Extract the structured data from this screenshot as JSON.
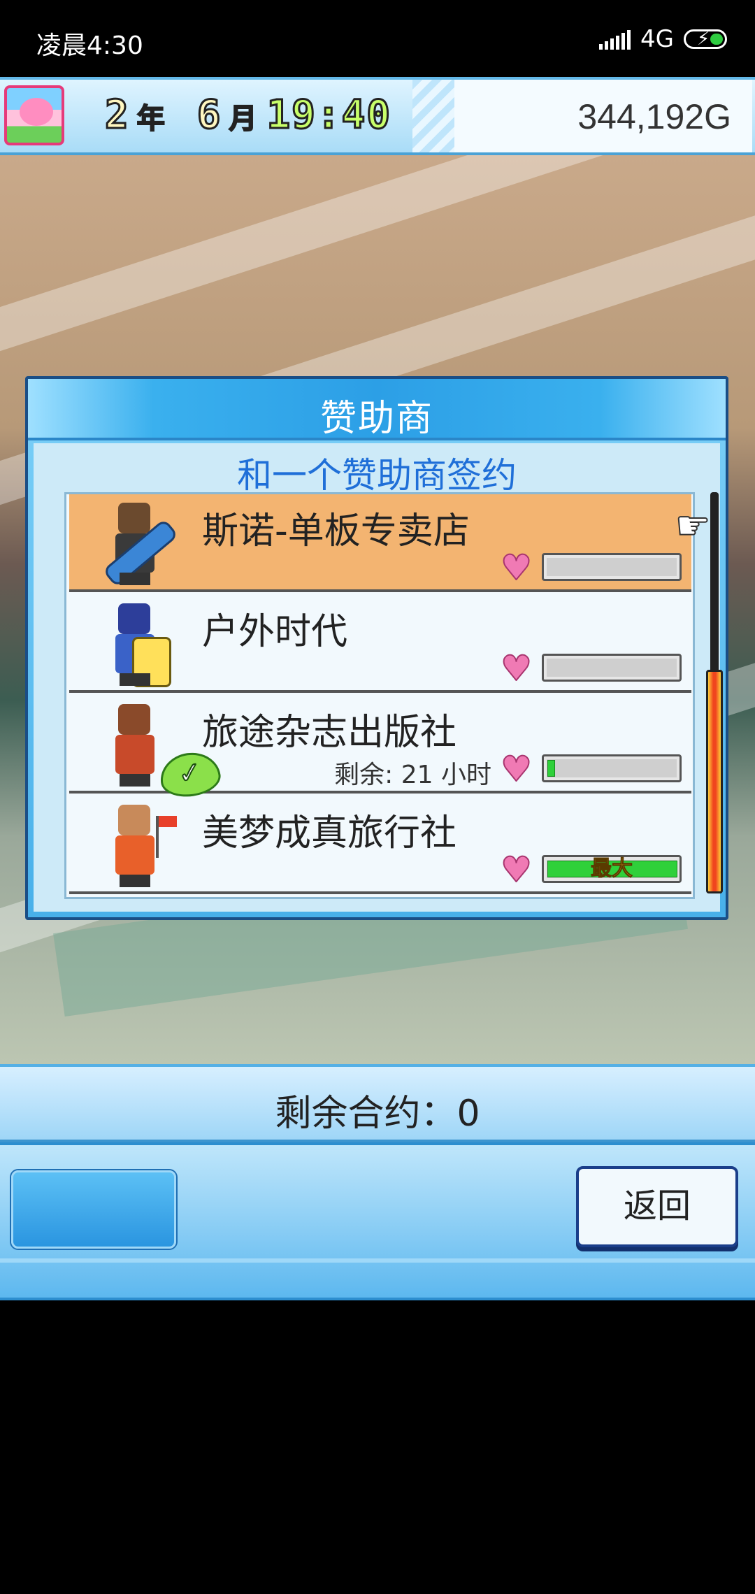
{
  "status_bar": {
    "time": "凌晨4:30",
    "network": "4G",
    "battery_icon": "battery-charging-icon",
    "signal_icon": "signal-icon"
  },
  "header": {
    "avatar_icon": "cherry-blossom-icon",
    "year_value": "2",
    "year_unit": "年",
    "month_value": "6",
    "month_unit": "月",
    "time": "19:40",
    "money": "344,192G"
  },
  "dialog": {
    "title": "赞助商",
    "subtitle": "和一个赞助商签约",
    "sponsors": [
      {
        "name": "斯诺-单板专卖店",
        "remaining": "",
        "affinity": 0,
        "max_label": "",
        "selected": true,
        "character_icon": "snowboarder-icon"
      },
      {
        "name": "户外时代",
        "remaining": "",
        "affinity": 0,
        "max_label": "",
        "selected": false,
        "character_icon": "hiker-icon"
      },
      {
        "name": "旅途杂志出版社",
        "remaining": "剩余: 21 小时",
        "affinity": 0.05,
        "max_label": "",
        "selected": false,
        "character_icon": "writer-icon",
        "contracted": true
      },
      {
        "name": "美梦成真旅行社",
        "remaining": "",
        "affinity": 1.0,
        "max_label": "最大",
        "selected": false,
        "character_icon": "tour-guide-icon"
      }
    ],
    "heart_icon": "heart-icon",
    "check_icon": "checkmark-badge-icon",
    "pointer_icon": "hand-pointer-icon"
  },
  "footer": {
    "remaining_contracts": "剩余合约：0",
    "back_label": "返回"
  },
  "colors": {
    "selected_row": "#f3b471",
    "accent_blue": "#1f6fd8",
    "heart": "#f07ab4",
    "bar_fill": "#2fd03a"
  }
}
